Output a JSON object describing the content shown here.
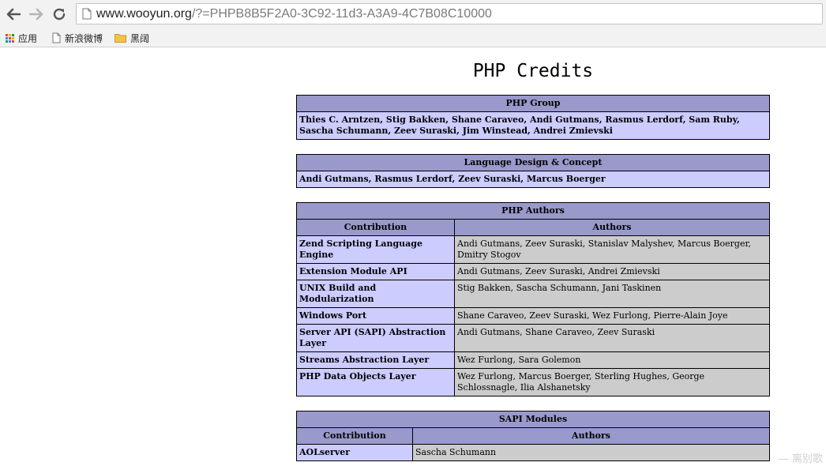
{
  "browser": {
    "url_host": "www.wooyun.org",
    "url_rest": "/?=PHPB8B5F2A0-3C92-11d3-A3A9-4C7B08C10000",
    "bookmarks": [
      {
        "label": "应用",
        "icon": "apps-grid-icon"
      },
      {
        "label": "新浪微博",
        "icon": "page-icon"
      },
      {
        "label": "黑阔",
        "icon": "folder-icon"
      }
    ]
  },
  "page": {
    "title": "PHP Credits",
    "php_group": {
      "header": "PHP Group",
      "text": "Thies C. Arntzen, Stig Bakken, Shane Caraveo, Andi Gutmans, Rasmus Lerdorf, Sam Ruby, Sascha Schumann, Zeev Suraski, Jim Winstead, Andrei Zmievski"
    },
    "language_design": {
      "header": "Language Design & Concept",
      "text": "Andi Gutmans, Rasmus Lerdorf, Zeev Suraski, Marcus Boerger"
    },
    "php_authors": {
      "header": "PHP Authors",
      "col_contribution": "Contribution",
      "col_authors": "Authors",
      "rows": [
        {
          "contribution": "Zend Scripting Language Engine",
          "authors": "Andi Gutmans, Zeev Suraski, Stanislav Malyshev, Marcus Boerger, Dmitry Stogov"
        },
        {
          "contribution": "Extension Module API",
          "authors": "Andi Gutmans, Zeev Suraski, Andrei Zmievski"
        },
        {
          "contribution": "UNIX Build and Modularization",
          "authors": "Stig Bakken, Sascha Schumann, Jani Taskinen"
        },
        {
          "contribution": "Windows Port",
          "authors": "Shane Caraveo, Zeev Suraski, Wez Furlong, Pierre-Alain Joye"
        },
        {
          "contribution": "Server API (SAPI) Abstraction Layer",
          "authors": "Andi Gutmans, Shane Caraveo, Zeev Suraski"
        },
        {
          "contribution": "Streams Abstraction Layer",
          "authors": "Wez Furlong, Sara Golemon"
        },
        {
          "contribution": "PHP Data Objects Layer",
          "authors": "Wez Furlong, Marcus Boerger, Sterling Hughes, George Schlossnagle, Ilia Alshanetsky"
        }
      ]
    },
    "sapi_modules": {
      "header": "SAPI Modules",
      "col_contribution": "Contribution",
      "col_authors": "Authors",
      "rows": [
        {
          "contribution": "AOLserver",
          "authors": "Sascha Schumann"
        }
      ]
    },
    "watermark": "— 离别歌"
  },
  "colors": {
    "header_bg": "#9999cc",
    "label_bg": "#ccccff",
    "value_bg": "#cccccc"
  }
}
